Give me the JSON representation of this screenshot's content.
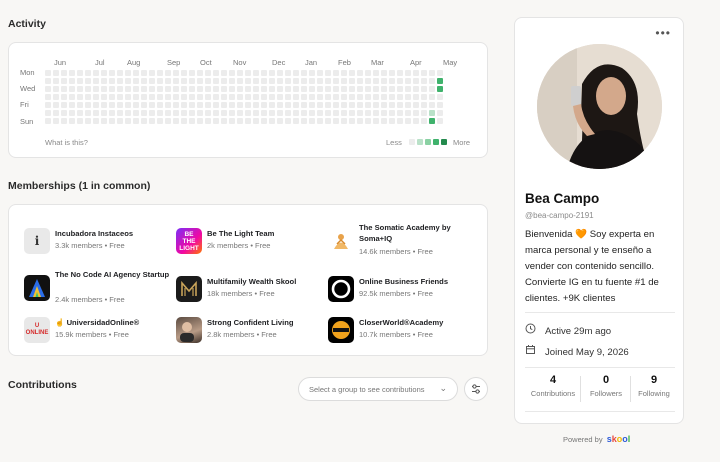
{
  "activity": {
    "title": "Activity",
    "months": [
      "Jun",
      "Jul",
      "Aug",
      "Sep",
      "Oct",
      "Nov",
      "Dec",
      "Jan",
      "Feb",
      "Mar",
      "Apr",
      "May"
    ],
    "days": [
      "Mon",
      "Wed",
      "Fri",
      "Sun"
    ],
    "what_link": "What is this?",
    "legend_less": "Less",
    "legend_more": "More",
    "active_cells": [
      {
        "week": 49,
        "day": 1,
        "level": 3
      },
      {
        "week": 49,
        "day": 2,
        "level": 3
      },
      {
        "week": 48,
        "day": 5,
        "level": 1
      },
      {
        "week": 48,
        "day": 6,
        "level": 3
      }
    ],
    "colors": {
      "empty": "#ececec",
      "l1": "#b9e1c8",
      "l2": "#8ad1a3",
      "l3": "#3fb26c",
      "l4": "#238a4d"
    }
  },
  "memberships": {
    "title": "Memberships (1 in common)",
    "groups": [
      {
        "name": "Incubadora Instaceos",
        "meta": "3.3k members • Free",
        "icon": "info-icon"
      },
      {
        "name": "Be The Light Team",
        "meta": "2k members • Free",
        "icon": "be-the-light-logo"
      },
      {
        "name": "The Somatic Academy by Soma+IQ",
        "meta": "14.6k members • Free",
        "icon": "somatic-logo"
      },
      {
        "name": "The No Code AI Agency Startup",
        "meta": "2.4k members • Free",
        "icon": "no-code-logo"
      },
      {
        "name": "Multifamily Wealth Skool",
        "meta": "18k members • Free",
        "icon": "multifamily-logo"
      },
      {
        "name": "Online Business Friends",
        "meta": "92.5k members • Free",
        "icon": "obf-logo"
      },
      {
        "name": "☝️ UniversidadOnline®",
        "meta": "15.9k members • Free",
        "icon": "universidad-logo"
      },
      {
        "name": "Strong Confident Living",
        "meta": "2.8k members • Free",
        "icon": "strong-logo"
      },
      {
        "name": "CloserWorld®Academy",
        "meta": "10.7k members • Free",
        "icon": "closer-logo"
      }
    ]
  },
  "contributions": {
    "title": "Contributions",
    "select_placeholder": "Select a group to see contributions"
  },
  "profile": {
    "name": "Bea Campo",
    "handle": "@bea-campo-2191",
    "bio": "Bienvenida 🧡 Soy experta en marca personal y te enseño a vender con contenido sencillo. Convierte IG en tu fuente #1 de clientes. +9K clientes",
    "active": "Active 29m ago",
    "joined": "Joined May 9, 2026",
    "stats": [
      {
        "num": "4",
        "label": "Contributions"
      },
      {
        "num": "0",
        "label": "Followers"
      },
      {
        "num": "9",
        "label": "Following"
      }
    ]
  },
  "footer": {
    "powered_by": "Powered by",
    "brand_letters": [
      "s",
      "k",
      "o",
      "o",
      "l"
    ],
    "brand_colors": [
      "#2e5bd8",
      "#e8473e",
      "#f2b705",
      "#2e5bd8",
      "#37b34a"
    ]
  }
}
